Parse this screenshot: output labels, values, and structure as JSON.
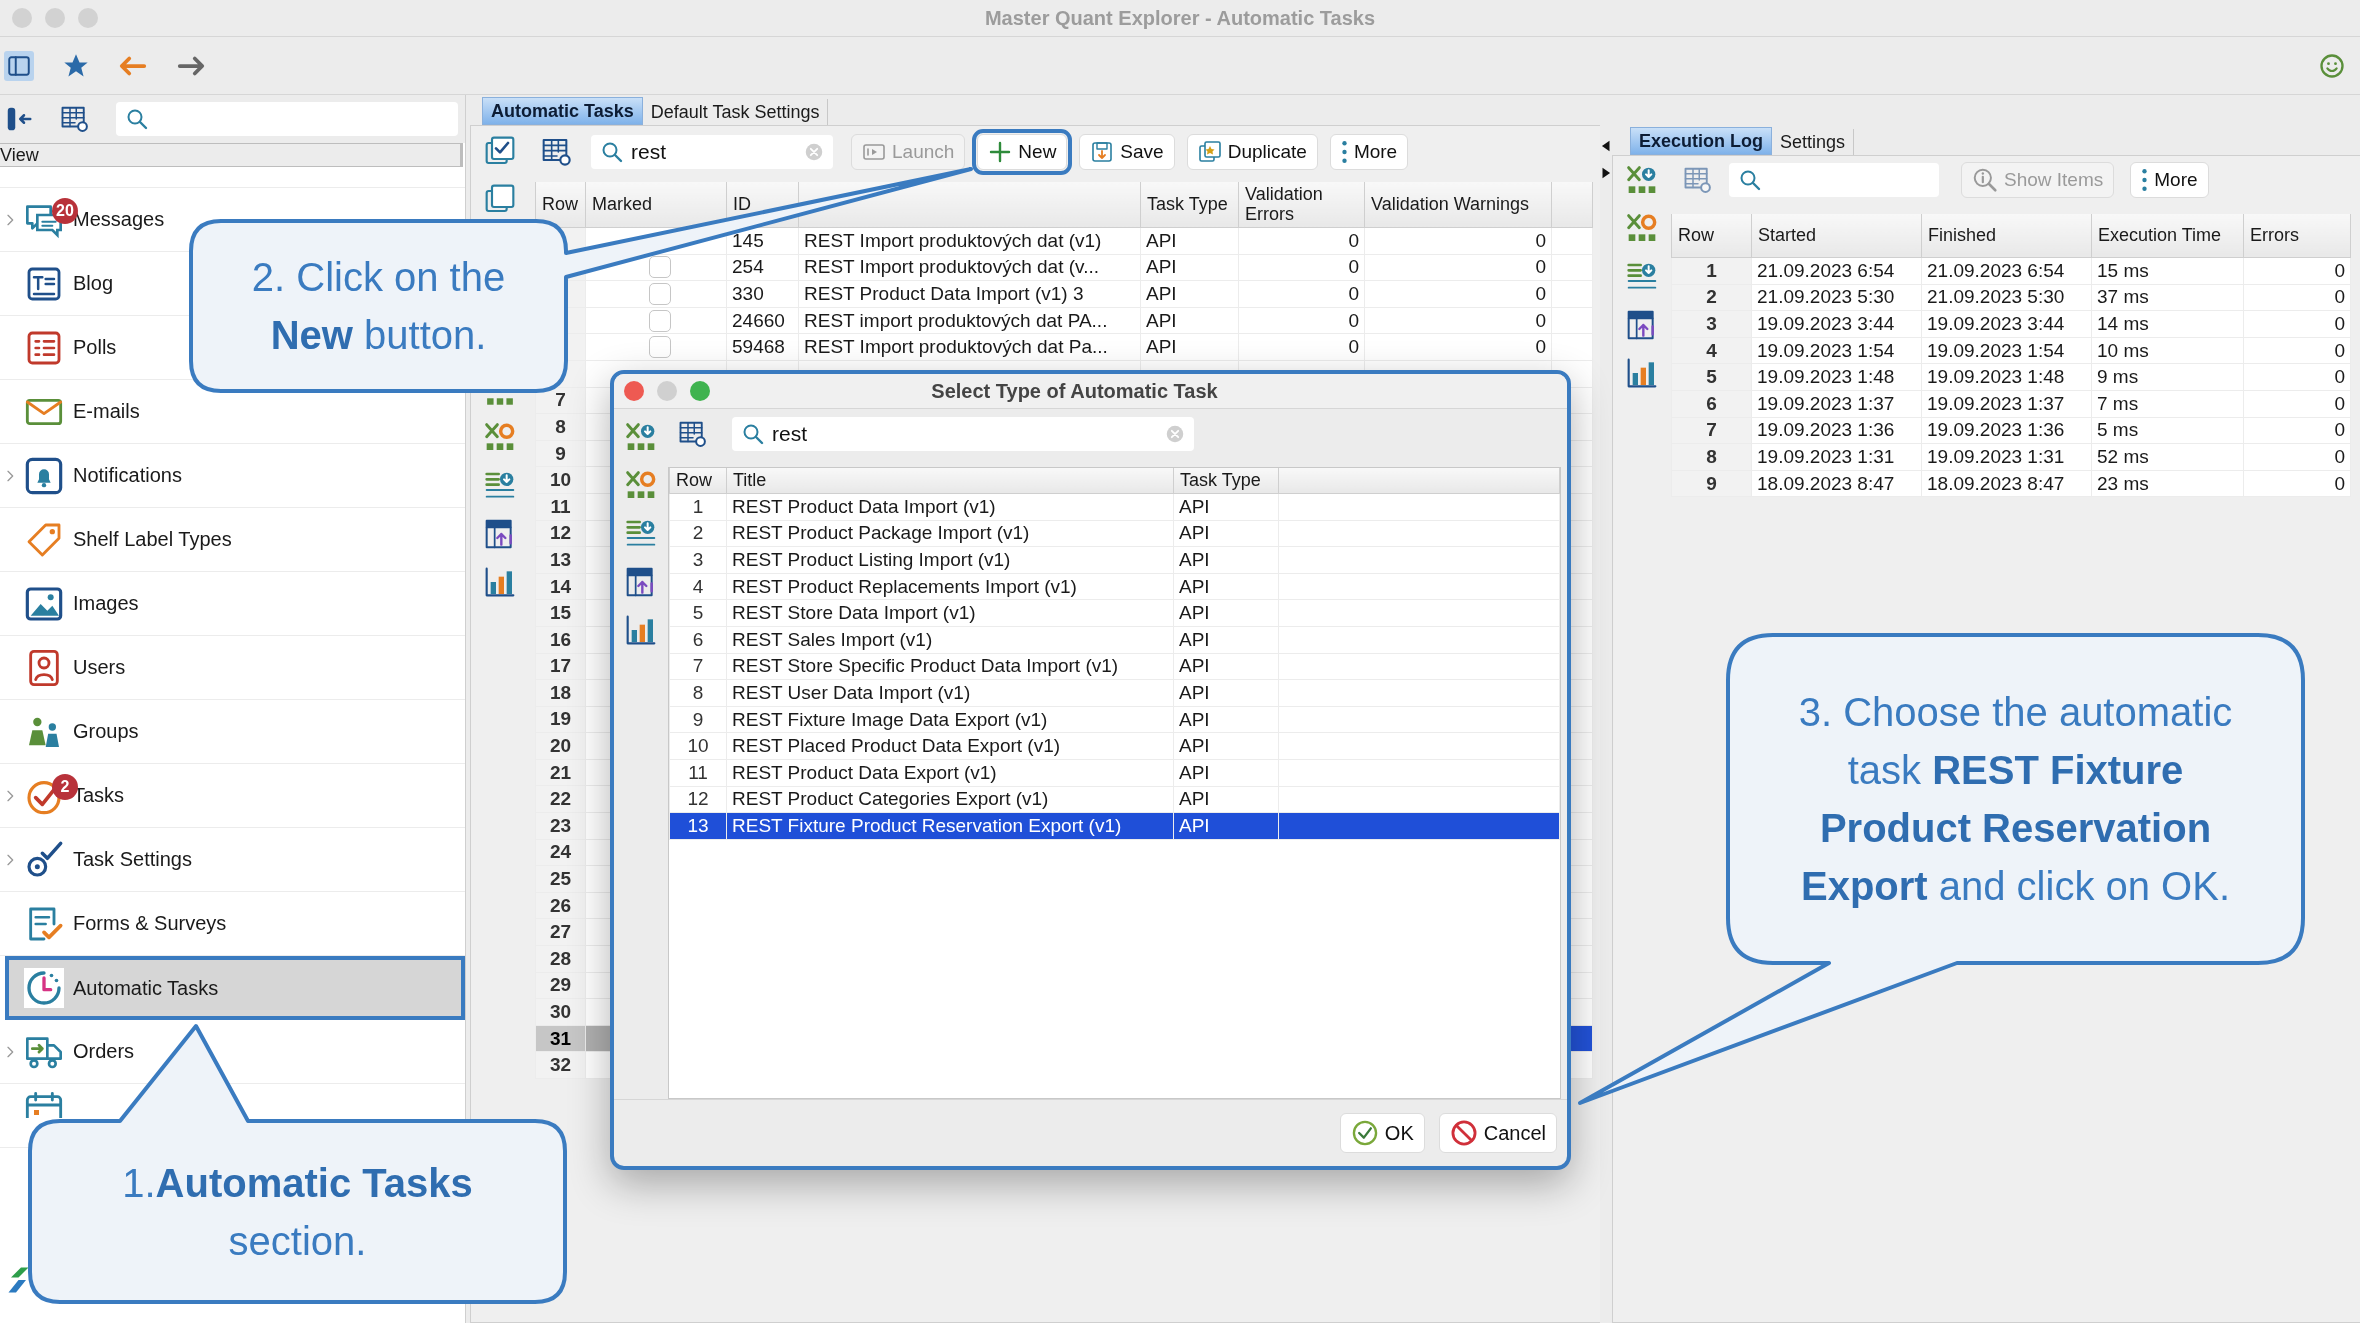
{
  "window": {
    "title": "Master Quant Explorer - Automatic Tasks"
  },
  "toolbar": {
    "sidebar_visible": true
  },
  "sidebar": {
    "view_label": "View",
    "items": [
      {
        "label": "Messages",
        "badge": "20",
        "expandable": true,
        "selected": false
      },
      {
        "label": "Blog",
        "expandable": false,
        "selected": false
      },
      {
        "label": "Polls",
        "expandable": false,
        "selected": false
      },
      {
        "label": "E-mails",
        "expandable": false,
        "selected": false
      },
      {
        "label": "Notifications",
        "expandable": true,
        "selected": false
      },
      {
        "label": "Shelf Label Types",
        "expandable": false,
        "selected": false
      },
      {
        "label": "Images",
        "expandable": false,
        "selected": false
      },
      {
        "label": "Users",
        "expandable": false,
        "selected": false
      },
      {
        "label": "Groups",
        "expandable": false,
        "selected": false
      },
      {
        "label": "Tasks",
        "badge": "2",
        "expandable": true,
        "selected": false
      },
      {
        "label": "Task Settings",
        "expandable": true,
        "selected": false
      },
      {
        "label": "Forms & Surveys",
        "expandable": false,
        "selected": false
      },
      {
        "label": "Automatic Tasks",
        "expandable": false,
        "selected": true
      },
      {
        "label": "Orders",
        "expandable": true,
        "selected": false
      },
      {
        "expandable": false,
        "selected": false
      }
    ]
  },
  "main": {
    "tabs": [
      {
        "label": "Automatic Tasks",
        "selected": true
      },
      {
        "label": "Default Task Settings",
        "selected": false
      }
    ],
    "search": {
      "value": "rest"
    },
    "buttons": [
      {
        "label": "Launch",
        "disabled": true,
        "highlighted": false
      },
      {
        "label": "New",
        "disabled": false,
        "highlighted": true
      },
      {
        "label": "Save",
        "disabled": false,
        "highlighted": false
      },
      {
        "label": "Duplicate",
        "disabled": false,
        "highlighted": false
      },
      {
        "label": "More",
        "disabled": false,
        "highlighted": false
      }
    ],
    "table": {
      "columns": [
        {
          "label": "Row"
        },
        {
          "label": "Marked"
        },
        {
          "label": "ID"
        },
        {},
        {
          "label": "Task Type"
        },
        {
          "label": "Validation Errors"
        },
        {
          "label": "Validation Warnings"
        }
      ],
      "rows": [
        {
          "id": "145",
          "title": "REST Import produktových dat (v1)",
          "task_type": "API",
          "validation_errors": "0",
          "validation_warnings": "0",
          "selected": false
        },
        {
          "marked": false,
          "id": "254",
          "title": "REST Import produktových dat (v...",
          "task_type": "API",
          "validation_errors": "0",
          "validation_warnings": "0",
          "selected": false
        },
        {
          "marked": false,
          "id": "330",
          "title": "REST Product Data Import (v1) 3",
          "task_type": "API",
          "validation_errors": "0",
          "validation_warnings": "0",
          "selected": false
        },
        {
          "marked": false,
          "id": "24660",
          "title": "REST import produktových dat PA...",
          "task_type": "API",
          "validation_errors": "0",
          "validation_warnings": "0",
          "selected": false
        },
        {
          "marked": false,
          "id": "59468",
          "title": "REST Import produktových dat Pa...",
          "task_type": "API",
          "validation_errors": "0",
          "validation_warnings": "0",
          "selected": false
        },
        {
          "selected": false
        },
        {
          "row": "7",
          "selected": false
        },
        {
          "row": "8",
          "selected": false
        },
        {
          "row": "9",
          "selected": false
        },
        {
          "row": "10",
          "selected": false
        },
        {
          "row": "11",
          "selected": false
        },
        {
          "row": "12",
          "selected": false
        },
        {
          "row": "13",
          "selected": false
        },
        {
          "row": "14",
          "selected": false
        },
        {
          "row": "15",
          "selected": false
        },
        {
          "row": "16",
          "selected": false
        },
        {
          "row": "17",
          "selected": false
        },
        {
          "row": "18",
          "selected": false
        },
        {
          "row": "19",
          "selected": false
        },
        {
          "row": "20",
          "selected": false
        },
        {
          "row": "21",
          "selected": false
        },
        {
          "row": "22",
          "selected": false
        },
        {
          "row": "23",
          "selected": false
        },
        {
          "row": "24",
          "selected": false
        },
        {
          "row": "25",
          "selected": false
        },
        {
          "row": "26",
          "selected": false
        },
        {
          "row": "27",
          "selected": false
        },
        {
          "row": "28",
          "selected": false
        },
        {
          "row": "29",
          "selected": false
        },
        {
          "row": "30",
          "selected": false
        },
        {
          "row": "31",
          "selected": true
        },
        {
          "row": "32",
          "selected": false
        }
      ]
    }
  },
  "execution_panel": {
    "tabs": [
      {
        "label": "Execution Log",
        "selected": true
      },
      {
        "label": "Settings",
        "selected": false
      }
    ],
    "buttons": [
      {
        "label": "Show Items",
        "disabled": true
      },
      {
        "label": "More",
        "disabled": false
      }
    ],
    "table": {
      "columns": [
        "Row",
        "Started",
        "Finished",
        "Execution Time",
        "Errors"
      ],
      "rows": [
        {
          "row": "1",
          "started": "21.09.2023 6:54",
          "finished": "21.09.2023 6:54",
          "execution_time": "15 ms",
          "errors": "0"
        },
        {
          "row": "2",
          "started": "21.09.2023 5:30",
          "finished": "21.09.2023 5:30",
          "execution_time": "37 ms",
          "errors": "0"
        },
        {
          "row": "3",
          "started": "19.09.2023 3:44",
          "finished": "19.09.2023 3:44",
          "execution_time": "14 ms",
          "errors": "0"
        },
        {
          "row": "4",
          "started": "19.09.2023 1:54",
          "finished": "19.09.2023 1:54",
          "execution_time": "10 ms",
          "errors": "0"
        },
        {
          "row": "5",
          "started": "19.09.2023 1:48",
          "finished": "19.09.2023 1:48",
          "execution_time": "9 ms",
          "errors": "0"
        },
        {
          "row": "6",
          "started": "19.09.2023 1:37",
          "finished": "19.09.2023 1:37",
          "execution_time": "7 ms",
          "errors": "0"
        },
        {
          "row": "7",
          "started": "19.09.2023 1:36",
          "finished": "19.09.2023 1:36",
          "execution_time": "5 ms",
          "errors": "0"
        },
        {
          "row": "8",
          "started": "19.09.2023 1:31",
          "finished": "19.09.2023 1:31",
          "execution_time": "52 ms",
          "errors": "0"
        },
        {
          "row": "9",
          "started": "18.09.2023 8:47",
          "finished": "18.09.2023 8:47",
          "execution_time": "23 ms",
          "errors": "0"
        }
      ]
    }
  },
  "dialog": {
    "title": "Select Type of Automatic Task",
    "search": {
      "value": "rest"
    },
    "table": {
      "columns": [
        "Row",
        "Title",
        "Task Type"
      ],
      "rows": [
        {
          "row": "1",
          "title": "REST Product Data Import (v1)",
          "task_type": "API",
          "selected": false
        },
        {
          "row": "2",
          "title": "REST Product Package Import (v1)",
          "task_type": "API",
          "selected": false
        },
        {
          "row": "3",
          "title": "REST Product Listing Import (v1)",
          "task_type": "API",
          "selected": false
        },
        {
          "row": "4",
          "title": "REST Product Replacements Import (v1)",
          "task_type": "API",
          "selected": false
        },
        {
          "row": "5",
          "title": "REST Store Data Import (v1)",
          "task_type": "API",
          "selected": false
        },
        {
          "row": "6",
          "title": "REST Sales Import (v1)",
          "task_type": "API",
          "selected": false
        },
        {
          "row": "7",
          "title": "REST Store Specific Product Data Import (v1)",
          "task_type": "API",
          "selected": false
        },
        {
          "row": "8",
          "title": "REST User Data Import (v1)",
          "task_type": "API",
          "selected": false
        },
        {
          "row": "9",
          "title": "REST Fixture Image Data Export (v1)",
          "task_type": "API",
          "selected": false
        },
        {
          "row": "10",
          "title": "REST Placed Product Data Export (v1)",
          "task_type": "API",
          "selected": false
        },
        {
          "row": "11",
          "title": "REST Product Data Export (v1)",
          "task_type": "API",
          "selected": false
        },
        {
          "row": "12",
          "title": "REST Product Categories Export (v1)",
          "task_type": "API",
          "selected": false
        },
        {
          "row": "13",
          "title": "REST Fixture Product Reservation Export (v1)",
          "task_type": "API",
          "selected": true
        }
      ]
    },
    "buttons": [
      {
        "label": "OK"
      },
      {
        "label": "Cancel"
      }
    ]
  },
  "callouts": [
    {
      "text": "2. Click on the **New** button."
    },
    {
      "text": "1.**Automatic Tasks** section."
    },
    {
      "text": "3. Choose the automatic task **REST Fixture Product Reservation Export** and click on OK."
    }
  ]
}
